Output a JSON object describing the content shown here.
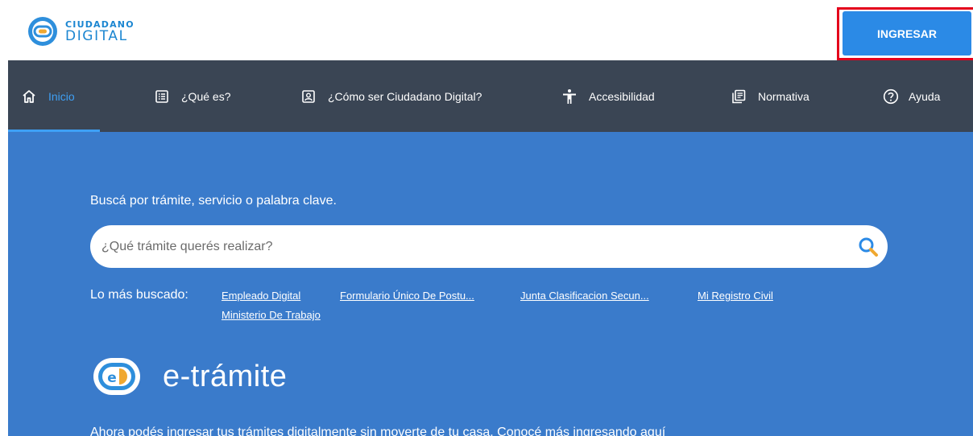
{
  "brand": {
    "top": "CIUDADANO",
    "bottom": "DIGITAL",
    "accent_color": "#1b86d1",
    "logo_icon": "ciudadano-digital-logo"
  },
  "header": {
    "login_label": "INGRESAR",
    "login_color": "#2b8ae6",
    "highlight_color": "#e4001b"
  },
  "nav": {
    "background": "#3a4554",
    "active_color": "#3ea0f5",
    "items": [
      {
        "label": "Inicio",
        "icon": "home-icon"
      },
      {
        "label": "¿Qué es?",
        "icon": "list-icon"
      },
      {
        "label": "¿Cómo ser Ciudadano Digital?",
        "icon": "id-card-icon"
      },
      {
        "label": "Accesibilidad",
        "icon": "accessibility-icon"
      },
      {
        "label": "Normativa",
        "icon": "document-icon"
      },
      {
        "label": "Ayuda",
        "icon": "help-icon"
      }
    ]
  },
  "hero": {
    "background": "#3a7bcb",
    "search_caption": "Buscá por trámite, servicio o palabra clave.",
    "search_placeholder": "¿Qué trámite querés realizar?",
    "popular_label": "Lo más buscado:",
    "popular_links": [
      "Empleado Digital",
      "Formulario Único De Postu...",
      "Junta Clasificacion Secun...",
      "Mi Registro Civil",
      "Ministerio De Trabajo"
    ],
    "etramite_title": "e-trámite",
    "etramite_description": "Ahora podés ingresar tus trámites digitalmente sin moverte de tu casa. Conocé más ingresando aquí"
  }
}
